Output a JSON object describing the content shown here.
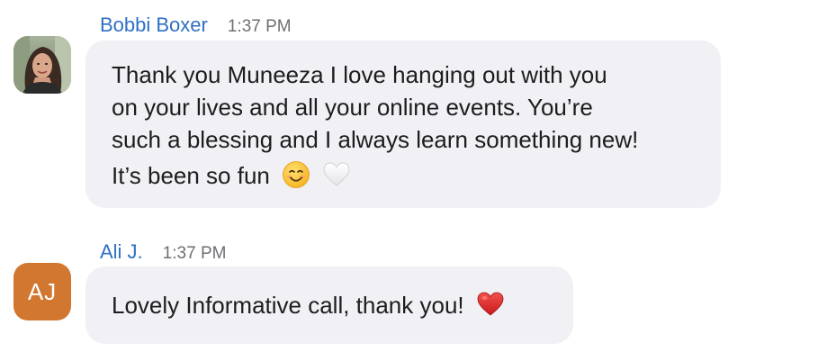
{
  "messages": [
    {
      "sender": "Bobbi Boxer",
      "time": "1:37 PM",
      "avatar_type": "photo",
      "lines": [
        "Thank you Muneeza I love hanging out with you",
        "on your lives and all your online events. You’re",
        "such a blessing and I always learn something new!",
        "It’s been so fun"
      ],
      "emojis": [
        "smiling-face-emoji",
        "white-heart-emoji"
      ]
    },
    {
      "sender": "Ali J.",
      "time": "1:37 PM",
      "avatar_type": "initials",
      "avatar_initials": "AJ",
      "avatar_color": "#d2772f",
      "lines": [
        "Lovely Informative call, thank you!"
      ],
      "emojis": [
        "red-heart-emoji"
      ]
    }
  ],
  "colors": {
    "sender_name": "#2f6fc4",
    "timestamp": "#6f6f74",
    "bubble_background": "#f0f0f5",
    "text": "#1d1d1f"
  }
}
